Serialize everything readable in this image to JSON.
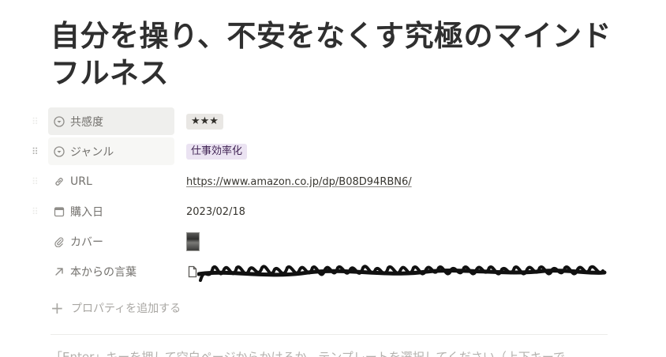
{
  "page": {
    "title": "自分を操り、不安をなくす究極のマインドフルネス"
  },
  "properties": [
    {
      "icon": "select-icon",
      "name": "共感度",
      "type": "tag",
      "value": "★★★",
      "tag_color": "#e9e7e4"
    },
    {
      "icon": "select-icon",
      "name": "ジャンル",
      "type": "tag",
      "value": "仕事効率化",
      "tag_color": "#ebe3f2"
    },
    {
      "icon": "link-icon",
      "name": "URL",
      "type": "url",
      "value": "https://www.amazon.co.jp/dp/B08D94RBN6/"
    },
    {
      "icon": "calendar-icon",
      "name": "購入日",
      "type": "date",
      "value": "2023/02/18"
    },
    {
      "icon": "paperclip-icon",
      "name": "カバー",
      "type": "file",
      "value": ""
    },
    {
      "icon": "relation-arrow-icon",
      "name": "本からの言葉",
      "type": "relation",
      "value": ""
    }
  ],
  "add_property": {
    "label": "プロパティを追加する"
  },
  "body_hint": "「Enter」キーを押して空白ページからかけるか、テンプレートを選択してください（上下キーで"
}
